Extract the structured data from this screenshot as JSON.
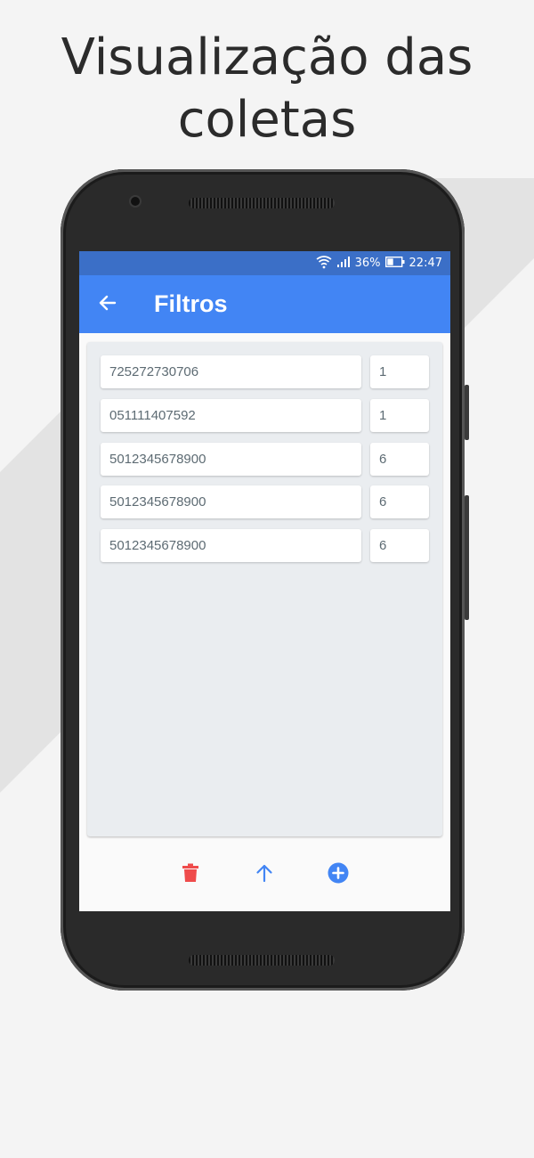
{
  "headline": {
    "line1": "Visualização das",
    "line2": "coletas"
  },
  "status_bar": {
    "battery": "36%",
    "time": "22:47"
  },
  "app_bar": {
    "title": "Filtros"
  },
  "collections": [
    {
      "code": "725272730706",
      "qty": "1"
    },
    {
      "code": "051111407592",
      "qty": "1"
    },
    {
      "code": "5012345678900",
      "qty": "6"
    },
    {
      "code": "5012345678900",
      "qty": "6"
    },
    {
      "code": "5012345678900",
      "qty": "6"
    }
  ],
  "colors": {
    "app_bar": "#4285f4",
    "status_bar": "#3b6fc7",
    "delete": "#ef4b4b",
    "accent": "#4285f4"
  },
  "icons": {
    "back": "arrow-left-icon",
    "delete": "trash-icon",
    "upload": "arrow-up-icon",
    "add": "plus-circle-icon"
  }
}
